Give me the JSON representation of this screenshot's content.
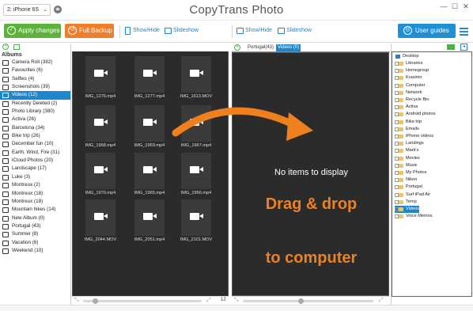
{
  "title_bar": {
    "device": "2: iPhone 6S",
    "app_title": "CopyTrans Photo",
    "window_buttons": [
      "minimize",
      "maximize",
      "close"
    ]
  },
  "toolbar": {
    "apply_label": "Apply changes",
    "backup_label": "Full Backup",
    "left_show_hide": "Show/Hide",
    "left_slideshow": "Slideshow",
    "right_show_hide": "Show/Hide",
    "right_slideshow": "Slideshow",
    "guides_label": "User guides",
    "colors": {
      "apply": "#5bb33a",
      "backup": "#f07d2a",
      "guides": "#1f8fd6"
    }
  },
  "albums": {
    "header": "Albums",
    "items": [
      {
        "label": "Camera Roll (382)",
        "icon": "camera-roll-icon"
      },
      {
        "label": "Favourites (6)",
        "icon": "heart-icon"
      },
      {
        "label": "Selfies (4)",
        "icon": "person-icon"
      },
      {
        "label": "Screenshots (39)",
        "icon": "screenshot-icon"
      },
      {
        "label": "Videos (12)",
        "icon": "video-icon",
        "selected": true
      },
      {
        "label": "Recently Deleted (2)",
        "icon": "trash-icon"
      },
      {
        "label": "Photo Library (380)",
        "icon": "camera-icon"
      },
      {
        "label": "Activa (26)",
        "icon": "album-icon"
      },
      {
        "label": "Barcelona (34)",
        "icon": "album-icon"
      },
      {
        "label": "Bike trip (26)",
        "icon": "album-icon"
      },
      {
        "label": "December fun (10)",
        "icon": "album-icon"
      },
      {
        "label": "Earth, Wind, Fire (31)",
        "icon": "album-icon"
      },
      {
        "label": "iCloud Photos (20)",
        "icon": "album-icon"
      },
      {
        "label": "Landscape (17)",
        "icon": "album-icon"
      },
      {
        "label": "Luke (3)",
        "icon": "album-icon"
      },
      {
        "label": "Montreux (2)",
        "icon": "album-icon"
      },
      {
        "label": "Montreux (18)",
        "icon": "album-icon"
      },
      {
        "label": "Montreux (18)",
        "icon": "album-icon"
      },
      {
        "label": "Mountain hikes (14)",
        "icon": "album-icon"
      },
      {
        "label": "New Album (0)",
        "icon": "album-icon"
      },
      {
        "label": "Portugal (43)",
        "icon": "album-icon"
      },
      {
        "label": "Summer (8)",
        "icon": "album-icon"
      },
      {
        "label": "Vacation (6)",
        "icon": "album-icon"
      },
      {
        "label": "Weekend (10)",
        "icon": "album-icon"
      }
    ]
  },
  "device_grid": {
    "items": [
      {
        "name": "IMG_1276.mp4"
      },
      {
        "name": "IMG_1277.mp4"
      },
      {
        "name": "IMG_1613.MOV"
      },
      {
        "name": "IMG_1968.mp4"
      },
      {
        "name": "IMG_1969.mp4"
      },
      {
        "name": "IMG_1967.mp4"
      },
      {
        "name": "IMG_1970.mp4"
      },
      {
        "name": "IMG_1965.mp4"
      },
      {
        "name": "IMG_1966.mp4"
      },
      {
        "name": "IMG_2044.MOV"
      },
      {
        "name": "IMG_2051.mp4"
      },
      {
        "name": "IMG_2101.MOV"
      }
    ],
    "count": "12"
  },
  "pc_panel": {
    "tabs": [
      "Portugal(43)",
      "Videos (0)"
    ],
    "active_tab": 1,
    "empty_text": "No items to display",
    "drag_line1": "Drag & drop",
    "drag_line2": "to computer",
    "accent": "#f0801e"
  },
  "folder_tree": {
    "root": "Desktop",
    "nodes": [
      "Libraries",
      "Homegroup",
      "Krasimir",
      "Computer",
      "Network",
      "Recycle Bin",
      "Activa",
      "Android photos",
      "Bike trip",
      "Emails",
      "iPhone videos",
      "Landings",
      "Mark's",
      "Movies",
      "Music",
      "My Photos",
      "Nikon",
      "Portugal",
      "Surf iPad Air",
      "Temp",
      "Videos",
      "Voice Memos"
    ],
    "selected": "Videos"
  }
}
